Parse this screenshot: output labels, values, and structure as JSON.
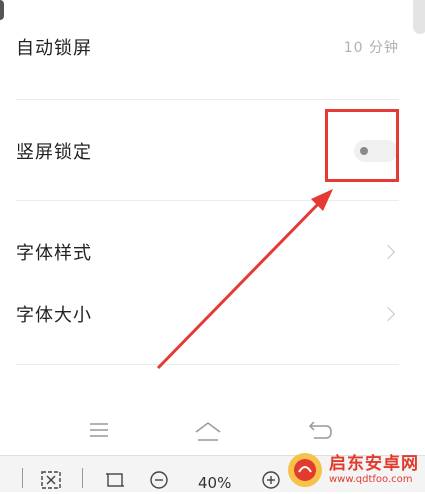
{
  "settings": {
    "auto_lock": {
      "label": "自动锁屏",
      "value": "10 分钟"
    },
    "portrait_lock": {
      "label": "竖屏锁定",
      "toggle_on": false
    },
    "font_style": {
      "label": "字体样式"
    },
    "font_size": {
      "label": "字体大小"
    }
  },
  "navigation": {
    "icons": [
      "menu-icon",
      "home-icon",
      "back-icon"
    ]
  },
  "toolbar": {
    "zoom_level": "40%",
    "icons": [
      "translate-icon",
      "crop-icon",
      "zoom-out-icon",
      "zoom-in-icon"
    ]
  },
  "watermark": {
    "name": "启东安卓网",
    "url": "www.qdtfoo.com"
  },
  "colors": {
    "annotation": "#e53935",
    "watermark": "#e23b2e",
    "toggle_off": "#f0f0f0"
  }
}
